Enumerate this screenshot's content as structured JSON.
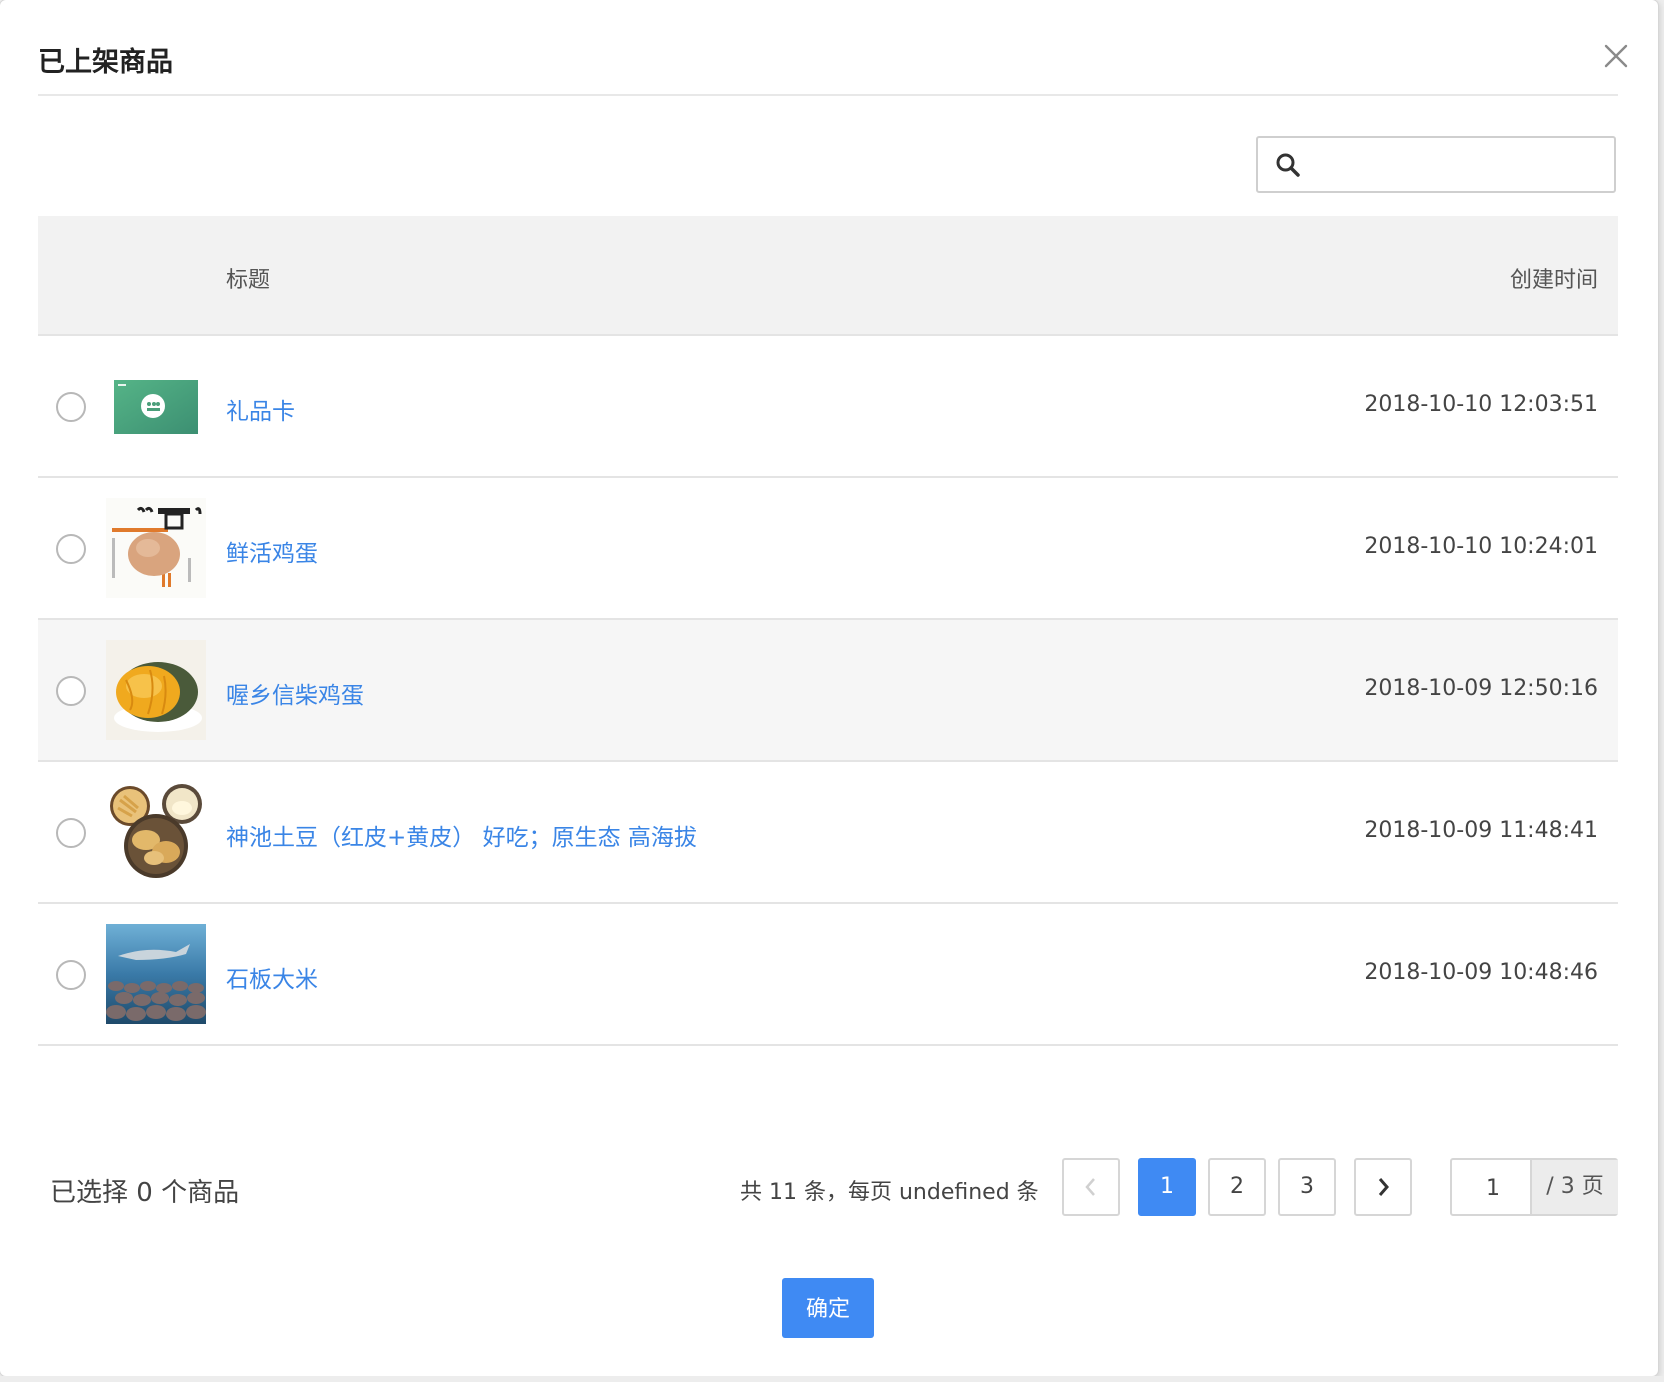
{
  "modal": {
    "title": "已上架商品"
  },
  "search": {
    "value": "",
    "placeholder": ""
  },
  "table": {
    "columns": {
      "title": "标题",
      "created": "创建时间"
    },
    "rows": [
      {
        "title": "礼品卡",
        "created": "2018-10-10 12:03:51",
        "thumb": "gift-card-image"
      },
      {
        "title": "鲜活鸡蛋",
        "created": "2018-10-10 10:24:01",
        "thumb": "egg-image"
      },
      {
        "title": "喔乡信柴鸡蛋",
        "created": "2018-10-09 12:50:16",
        "thumb": "pumpkin-image"
      },
      {
        "title": "神池土豆（红皮+黄皮） 好吃；原生态 高海拔",
        "created": "2018-10-09 11:48:41",
        "thumb": "potato-image"
      },
      {
        "title": "石板大米",
        "created": "2018-10-09 10:48:46",
        "thumb": "ocean-image"
      }
    ]
  },
  "footer": {
    "selected_text": "已选择 0 个商品",
    "total_text": "共 11 条，每页 undefined 条",
    "pages": [
      "1",
      "2",
      "3"
    ],
    "current_page": "1",
    "jump_value": "1",
    "jump_suffix": "/ 3 页",
    "confirm_label": "确定"
  },
  "colors": {
    "accent": "#3f8af3",
    "link": "#3a85e6"
  }
}
